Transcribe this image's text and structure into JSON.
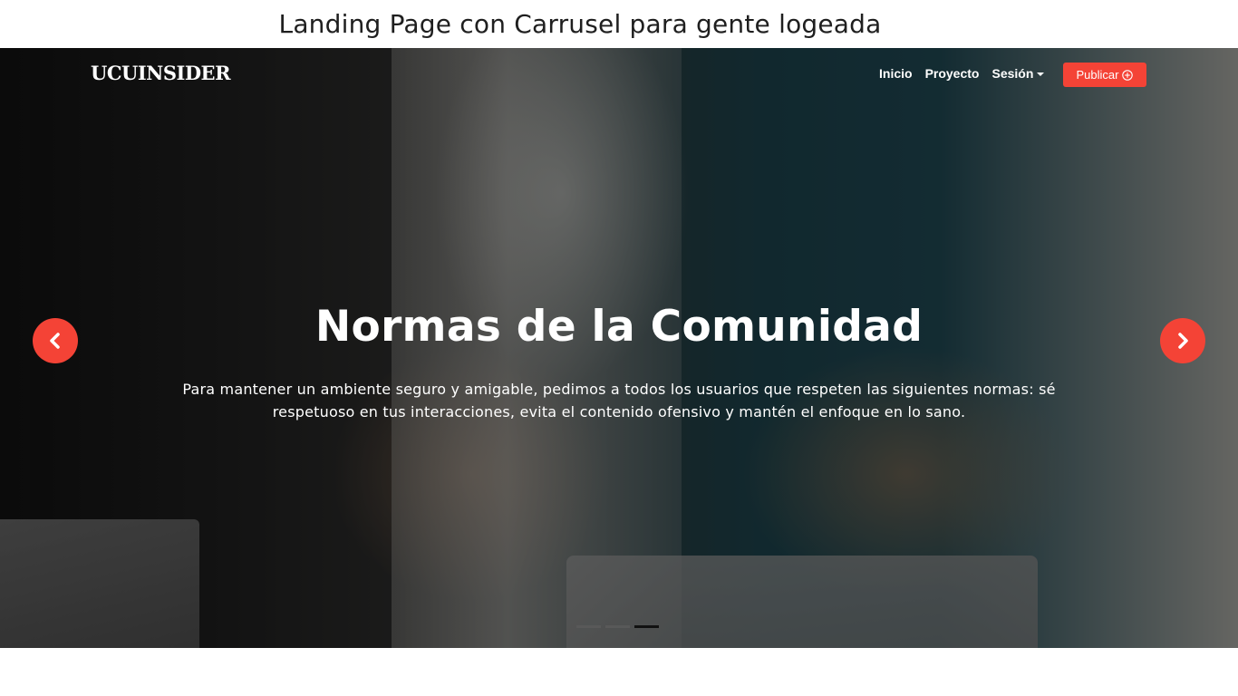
{
  "caption": "Landing Page con Carrusel para gente logeada",
  "navbar": {
    "brand": "UCUINSIDER",
    "links": [
      "Inicio",
      "Proyecto",
      "Sesión"
    ],
    "publish_label": "Publicar",
    "publish_icon": "plus-circle-icon"
  },
  "carousel": {
    "title": "Normas de la Comunidad",
    "text": "Para mantener un ambiente seguro y amigable, pedimos a todos los usuarios que respeten las siguientes normas: sé respetuoso en tus interacciones, evita el contenido ofensivo y mantén el enfoque en lo sano.",
    "prev_icon": "chevron-left-icon",
    "next_icon": "chevron-right-icon",
    "slide_count": 3,
    "active_index": 2
  },
  "colors": {
    "accent": "#f44336",
    "text": "#ffffff"
  }
}
